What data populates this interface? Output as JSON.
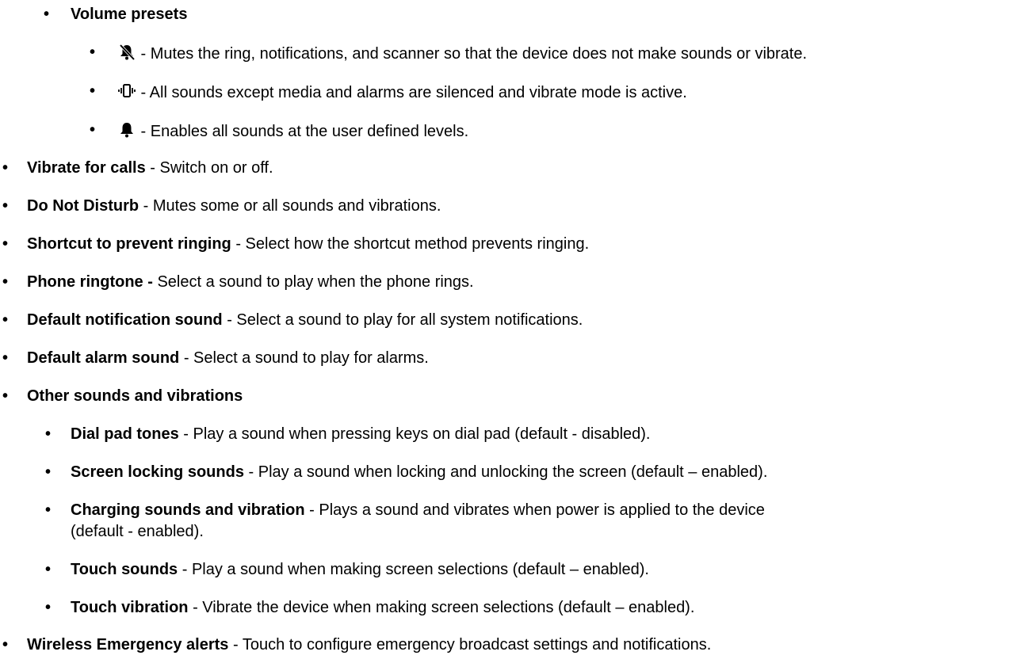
{
  "volume_presets": {
    "heading": "Volume presets",
    "items": [
      {
        "icon": "mute-bell-icon",
        "desc": " - Mutes the ring, notifications, and scanner so that the device does not make sounds or vibrate."
      },
      {
        "icon": "vibrate-icon",
        "desc": " - All sounds except media and alarms are silenced and vibrate mode is active."
      },
      {
        "icon": "bell-icon",
        "desc": " - Enables all sounds at the user defined levels."
      }
    ]
  },
  "items": [
    {
      "term": "Vibrate for calls",
      "desc": " - Switch on or off."
    },
    {
      "term": "Do Not Disturb",
      "desc": " - Mutes some or all sounds and vibrations."
    },
    {
      "term": "Shortcut to prevent ringing",
      "desc": " - Select how the shortcut method prevents ringing."
    },
    {
      "term": "Phone ringtone -",
      "desc": " Select a sound to play when the phone rings."
    },
    {
      "term": "Default notification sound",
      "desc": " - Select a sound to play for all system notifications."
    },
    {
      "term": "Default alarm sound",
      "desc": " - Select a sound to play for alarms."
    }
  ],
  "other_sounds": {
    "heading": "Other sounds and vibrations",
    "items": [
      {
        "term": "Dial pad tones",
        "desc": " - Play a sound when pressing keys on dial pad (default - disabled)."
      },
      {
        "term": "Screen locking sounds",
        "desc": " - Play a sound when locking and unlocking the screen (default – enabled)."
      },
      {
        "term": "Charging sounds and vibration",
        "desc": " - Plays a sound and vibrates when power is applied to the device",
        "desc_line2": "(default - enabled)."
      },
      {
        "term": "Touch sounds",
        "desc": " - Play a sound when making screen selections (default – enabled)."
      },
      {
        "term": "Touch vibration",
        "desc": " - Vibrate the device when making screen selections (default – enabled)."
      }
    ]
  },
  "last_item": {
    "term": "Wireless Emergency alerts",
    "desc": " - Touch to configure emergency broadcast settings and notifications."
  }
}
